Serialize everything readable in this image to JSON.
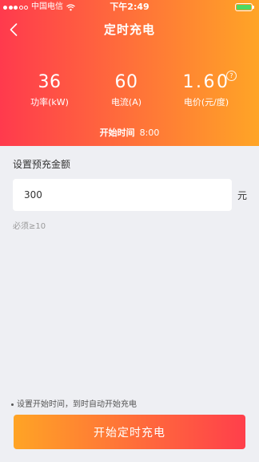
{
  "status_bar": {
    "carrier": "中国电信",
    "time": "下午2:49"
  },
  "header": {
    "title": "定时充电",
    "stats": [
      {
        "value": "36",
        "label": "功率(kW)"
      },
      {
        "value": "60",
        "label": "电流(A)"
      },
      {
        "value": "1.60",
        "label": "电价(元/度)",
        "help": "?"
      }
    ],
    "start_label": "开始时间",
    "start_time": "8:00"
  },
  "form": {
    "section_title": "设置预充金额",
    "amount_value": "300",
    "unit": "元",
    "hint": "必须≥10"
  },
  "footer": {
    "note": "设置开始时间，到时自动开始充电",
    "button_label": "开始定时充电"
  },
  "colors": {
    "header_gradient_start": "#ff3a4d",
    "header_gradient_end": "#ffa526",
    "button_gradient_start": "#ffa425",
    "button_gradient_end": "#ff3f4b",
    "background": "#eeeff3"
  }
}
